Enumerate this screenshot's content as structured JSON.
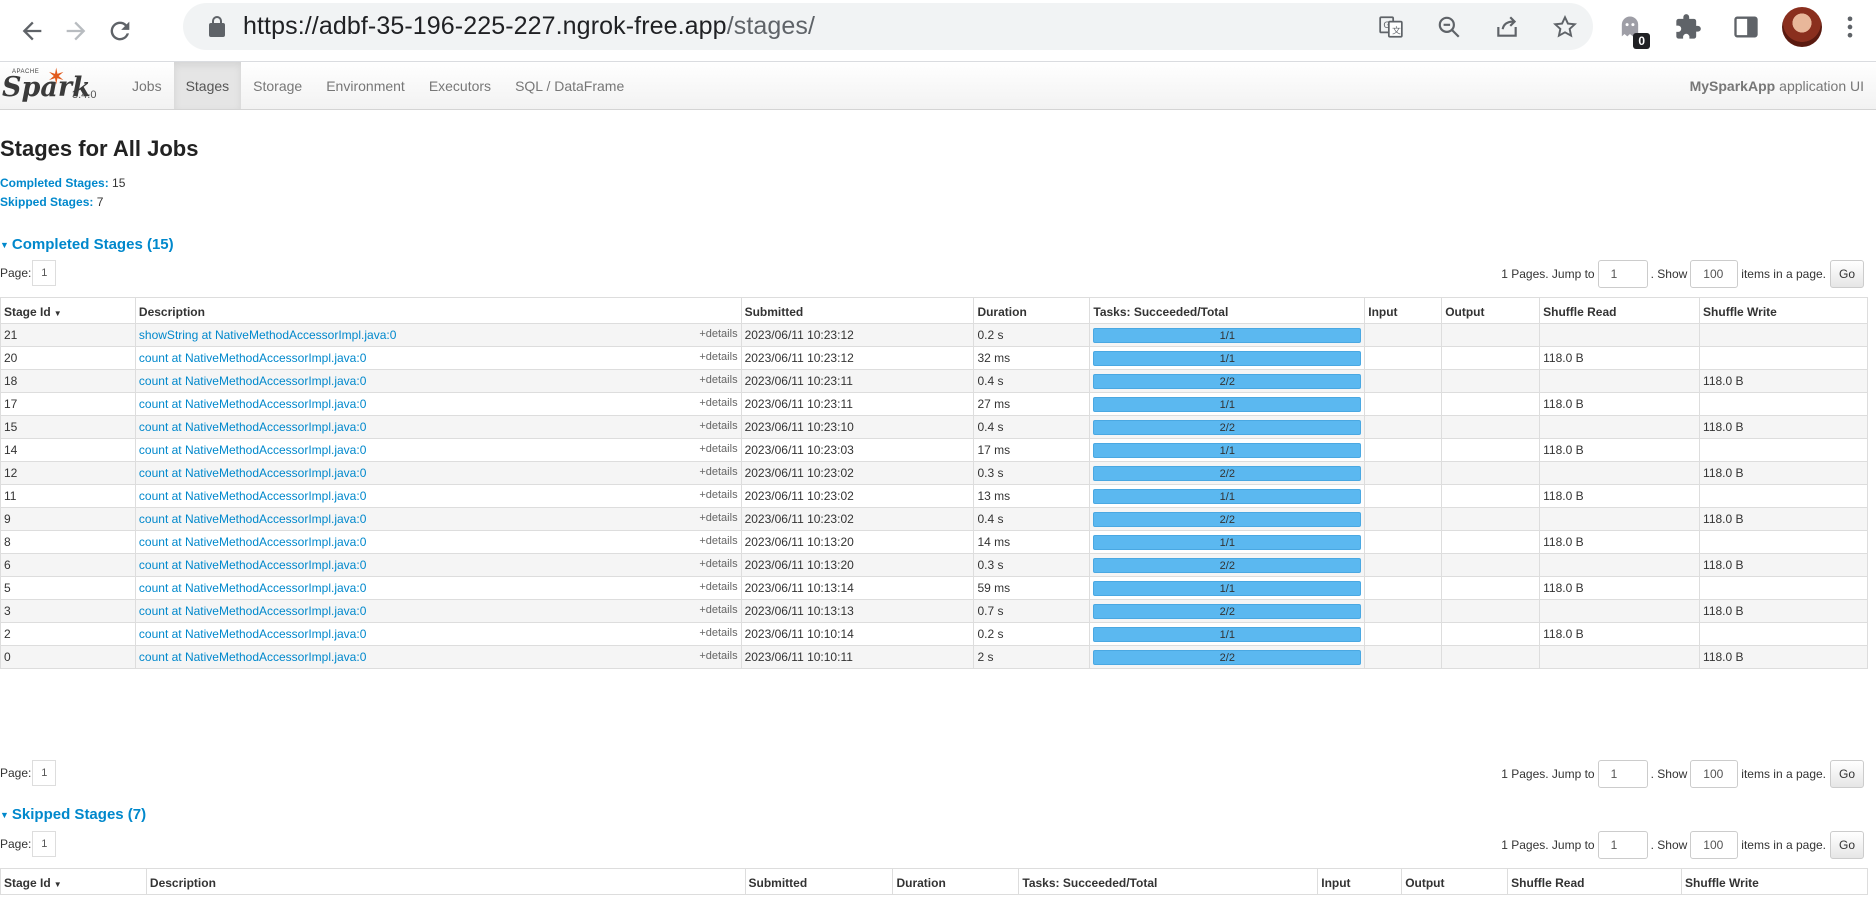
{
  "browser": {
    "url_host": "https://adbf-35-196-225-227.ngrok-free.app",
    "url_path": "/stages/",
    "ext_badge": "0"
  },
  "spark": {
    "version": "3.4.0",
    "nav": [
      "Jobs",
      "Stages",
      "Storage",
      "Environment",
      "Executors",
      "SQL / DataFrame"
    ],
    "active_nav": "Stages",
    "app_name": "MySparkApp",
    "app_suffix": "application UI"
  },
  "page": {
    "title": "Stages for All Jobs",
    "completed_label": "Completed Stages:",
    "completed_count": "15",
    "skipped_label": "Skipped Stages:",
    "skipped_count": "7"
  },
  "completed": {
    "heading": "Completed Stages (15)",
    "page_label": "Page:",
    "page_num": "1",
    "pages_text": "1 Pages. Jump to",
    "jump_value": "1",
    "show_text": ". Show",
    "show_value": "100",
    "items_text": "items in a page.",
    "go_label": "Go",
    "columns": [
      "Stage Id",
      "Description",
      "Submitted",
      "Duration",
      "Tasks: Succeeded/Total",
      "Input",
      "Output",
      "Shuffle Read",
      "Shuffle Write"
    ],
    "details_label": "+details",
    "rows": [
      {
        "id": "21",
        "desc": "showString at NativeMethodAccessorImpl.java:0",
        "submitted": "2023/06/11 10:23:12",
        "duration": "0.2 s",
        "tasks": "1/1",
        "input": "",
        "output": "",
        "read": "",
        "write": ""
      },
      {
        "id": "20",
        "desc": "count at NativeMethodAccessorImpl.java:0",
        "submitted": "2023/06/11 10:23:12",
        "duration": "32 ms",
        "tasks": "1/1",
        "input": "",
        "output": "",
        "read": "118.0 B",
        "write": ""
      },
      {
        "id": "18",
        "desc": "count at NativeMethodAccessorImpl.java:0",
        "submitted": "2023/06/11 10:23:11",
        "duration": "0.4 s",
        "tasks": "2/2",
        "input": "",
        "output": "",
        "read": "",
        "write": "118.0 B"
      },
      {
        "id": "17",
        "desc": "count at NativeMethodAccessorImpl.java:0",
        "submitted": "2023/06/11 10:23:11",
        "duration": "27 ms",
        "tasks": "1/1",
        "input": "",
        "output": "",
        "read": "118.0 B",
        "write": ""
      },
      {
        "id": "15",
        "desc": "count at NativeMethodAccessorImpl.java:0",
        "submitted": "2023/06/11 10:23:10",
        "duration": "0.4 s",
        "tasks": "2/2",
        "input": "",
        "output": "",
        "read": "",
        "write": "118.0 B"
      },
      {
        "id": "14",
        "desc": "count at NativeMethodAccessorImpl.java:0",
        "submitted": "2023/06/11 10:23:03",
        "duration": "17 ms",
        "tasks": "1/1",
        "input": "",
        "output": "",
        "read": "118.0 B",
        "write": ""
      },
      {
        "id": "12",
        "desc": "count at NativeMethodAccessorImpl.java:0",
        "submitted": "2023/06/11 10:23:02",
        "duration": "0.3 s",
        "tasks": "2/2",
        "input": "",
        "output": "",
        "read": "",
        "write": "118.0 B"
      },
      {
        "id": "11",
        "desc": "count at NativeMethodAccessorImpl.java:0",
        "submitted": "2023/06/11 10:23:02",
        "duration": "13 ms",
        "tasks": "1/1",
        "input": "",
        "output": "",
        "read": "118.0 B",
        "write": ""
      },
      {
        "id": "9",
        "desc": "count at NativeMethodAccessorImpl.java:0",
        "submitted": "2023/06/11 10:23:02",
        "duration": "0.4 s",
        "tasks": "2/2",
        "input": "",
        "output": "",
        "read": "",
        "write": "118.0 B"
      },
      {
        "id": "8",
        "desc": "count at NativeMethodAccessorImpl.java:0",
        "submitted": "2023/06/11 10:13:20",
        "duration": "14 ms",
        "tasks": "1/1",
        "input": "",
        "output": "",
        "read": "118.0 B",
        "write": ""
      },
      {
        "id": "6",
        "desc": "count at NativeMethodAccessorImpl.java:0",
        "submitted": "2023/06/11 10:13:20",
        "duration": "0.3 s",
        "tasks": "2/2",
        "input": "",
        "output": "",
        "read": "",
        "write": "118.0 B"
      },
      {
        "id": "5",
        "desc": "count at NativeMethodAccessorImpl.java:0",
        "submitted": "2023/06/11 10:13:14",
        "duration": "59 ms",
        "tasks": "1/1",
        "input": "",
        "output": "",
        "read": "118.0 B",
        "write": ""
      },
      {
        "id": "3",
        "desc": "count at NativeMethodAccessorImpl.java:0",
        "submitted": "2023/06/11 10:13:13",
        "duration": "0.7 s",
        "tasks": "2/2",
        "input": "",
        "output": "",
        "read": "",
        "write": "118.0 B"
      },
      {
        "id": "2",
        "desc": "count at NativeMethodAccessorImpl.java:0",
        "submitted": "2023/06/11 10:10:14",
        "duration": "0.2 s",
        "tasks": "1/1",
        "input": "",
        "output": "",
        "read": "118.0 B",
        "write": ""
      },
      {
        "id": "0",
        "desc": "count at NativeMethodAccessorImpl.java:0",
        "submitted": "2023/06/11 10:10:11",
        "duration": "2 s",
        "tasks": "2/2",
        "input": "",
        "output": "",
        "read": "",
        "write": "118.0 B"
      }
    ]
  },
  "skipped": {
    "heading": "Skipped Stages (7)",
    "page_label": "Page:",
    "page_num": "1",
    "pages_text": "1 Pages. Jump to",
    "jump_value": "1",
    "show_text": ". Show",
    "show_value": "100",
    "items_text": "items in a page.",
    "go_label": "Go",
    "columns": [
      "Stage Id",
      "Description",
      "Submitted",
      "Duration",
      "Tasks: Succeeded/Total",
      "Input",
      "Output",
      "Shuffle Read",
      "Shuffle Write"
    ]
  },
  "colors": {
    "link": "#0088cc",
    "progress": "#5bb8f0",
    "spark_orange": "#e25a1c"
  }
}
